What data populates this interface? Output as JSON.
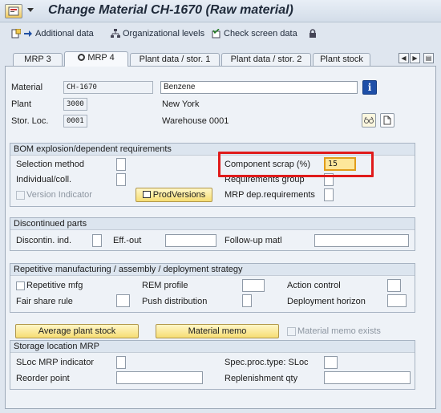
{
  "title": "Change Material CH-1670 (Raw material)",
  "toolbar": {
    "additional_data": "Additional data",
    "org_levels": "Organizational levels",
    "check_screen": "Check screen data"
  },
  "tabs": [
    "MRP 3",
    "MRP 4",
    "Plant data / stor. 1",
    "Plant data / stor. 2",
    "Plant stock"
  ],
  "header": {
    "material_label": "Material",
    "material_value": "CH-1670",
    "material_desc": "Benzene",
    "plant_label": "Plant",
    "plant_value": "3000",
    "plant_desc": "New York",
    "sloc_label": "Stor. Loc.",
    "sloc_value": "0001",
    "sloc_desc": "Warehouse 0001"
  },
  "bom": {
    "title": "BOM explosion/dependent requirements",
    "selection_method": "Selection method",
    "individual_coll": "Individual/coll.",
    "version_indicator": "Version Indicator",
    "prod_versions": "ProdVersions",
    "component_scrap": "Component scrap (%)",
    "component_scrap_value": "15",
    "requirements_group": "Requirements group",
    "mrp_dep_req": "MRP dep.requirements"
  },
  "discontinued": {
    "title": "Discontinued parts",
    "discontin_ind": "Discontin. ind.",
    "eff_out": "Eff.-out",
    "follow_up": "Follow-up matl"
  },
  "repetitive": {
    "title": "Repetitive manufacturing / assembly / deployment strategy",
    "repetitive_mfg": "Repetitive mfg",
    "rem_profile": "REM profile",
    "action_control": "Action control",
    "fair_share": "Fair share rule",
    "push_distribution": "Push distribution",
    "deployment_horizon": "Deployment horizon"
  },
  "buttons": {
    "avg_plant_stock": "Average plant stock",
    "material_memo": "Material memo",
    "memo_exists": "Material memo exists"
  },
  "storage": {
    "title": "Storage location MRP",
    "sloc_mrp_indicator": "SLoc MRP indicator",
    "reorder_point": "Reorder point",
    "spec_proc": "Spec.proc.type: SLoc",
    "replenishment_qty": "Replenishment qty"
  }
}
